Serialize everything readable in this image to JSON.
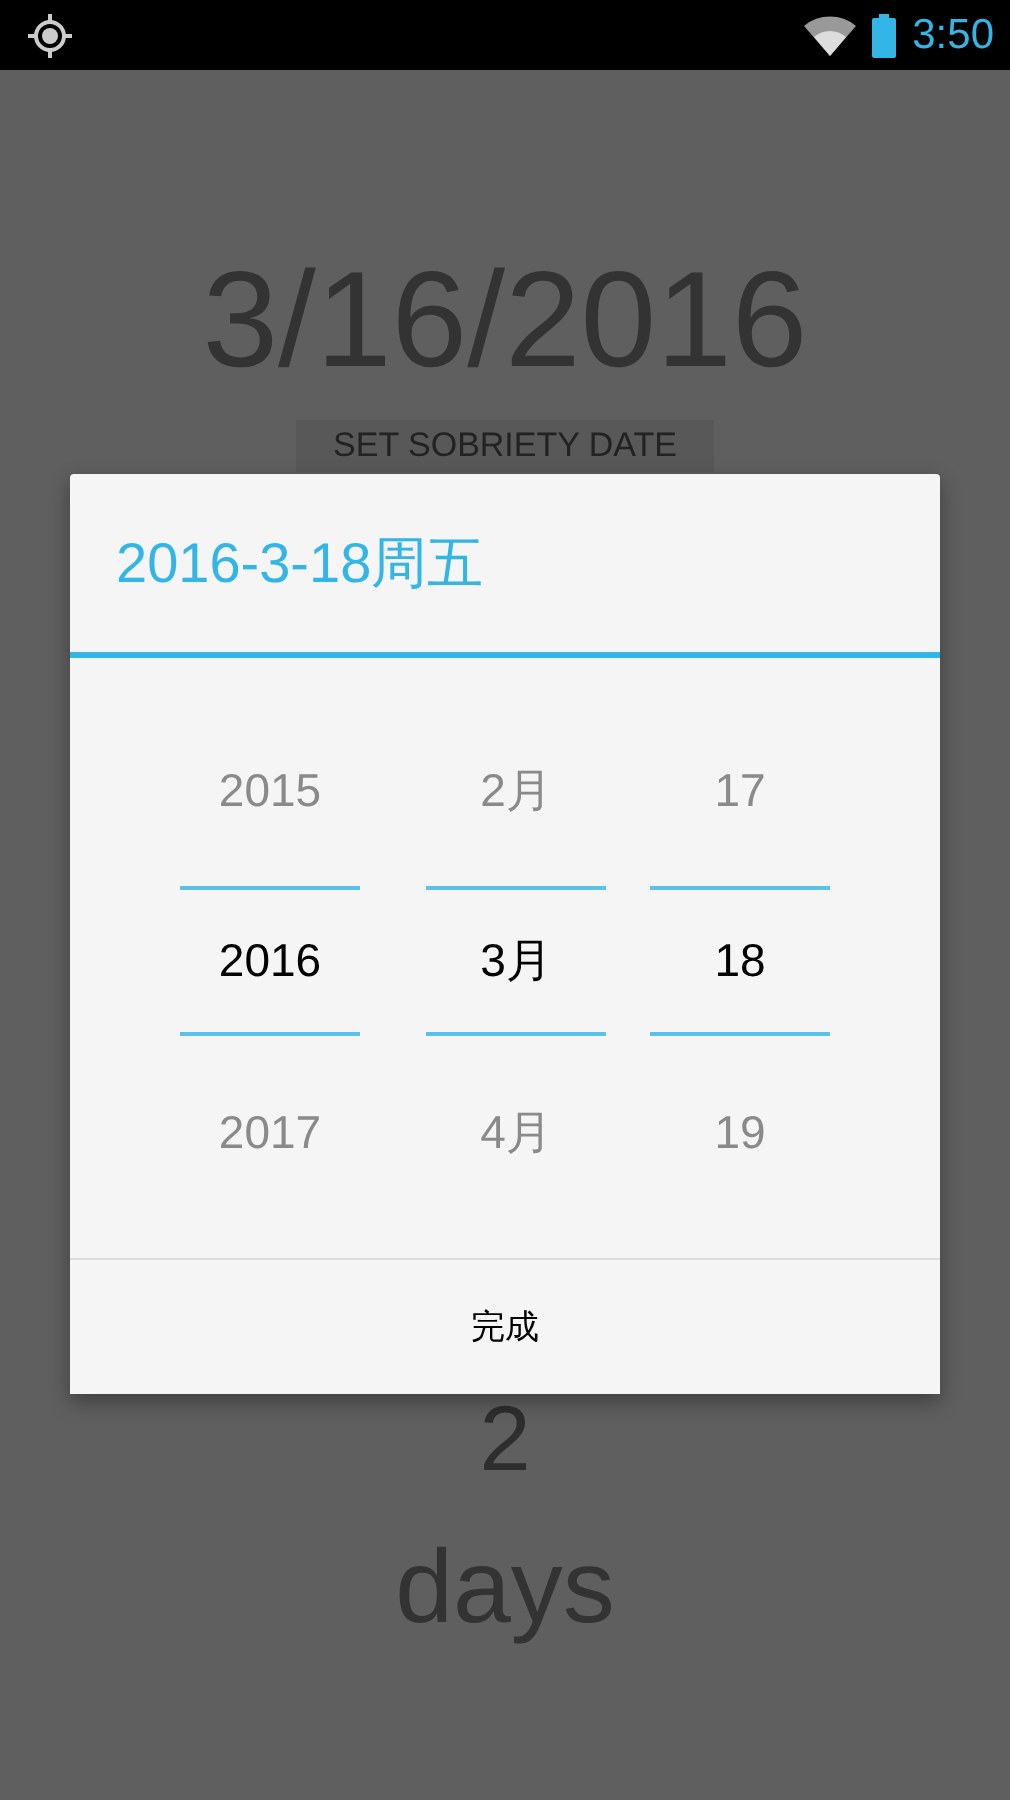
{
  "status_bar": {
    "time": "3:50"
  },
  "screen": {
    "date": "3/16/2016",
    "button": "SET SOBRIETY DATE",
    "count": "2",
    "unit": "days"
  },
  "dialog": {
    "title": "2016-3-18周五",
    "columns": [
      {
        "items": [
          {
            "label": "2015",
            "selected": false
          },
          {
            "label": "2016",
            "selected": true
          },
          {
            "label": "2017",
            "selected": false
          }
        ]
      },
      {
        "items": [
          {
            "label": "2月",
            "selected": false
          },
          {
            "label": "3月",
            "selected": true
          },
          {
            "label": "4月",
            "selected": false
          }
        ]
      },
      {
        "items": [
          {
            "label": "17",
            "selected": false
          },
          {
            "label": "18",
            "selected": true
          },
          {
            "label": "19",
            "selected": false
          }
        ]
      }
    ],
    "done_button": "完成"
  }
}
